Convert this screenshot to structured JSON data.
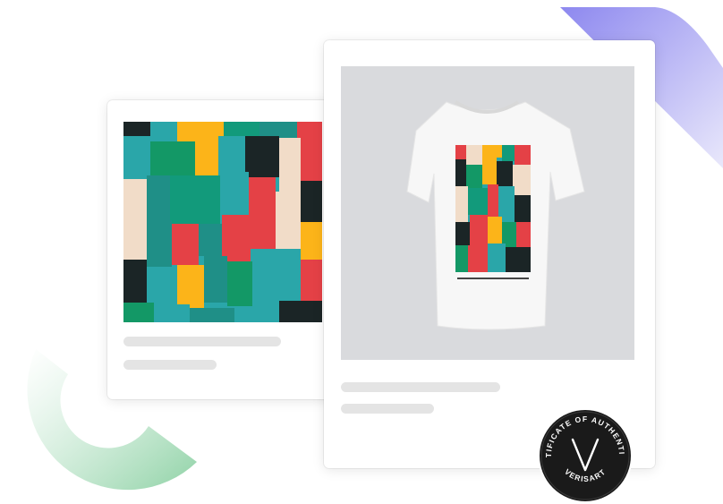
{
  "badge": {
    "ring_text": "CERTIFICATE OF AUTHENTICITY",
    "brand_text": "VERISART",
    "icon": "verisart-v-logo"
  },
  "colors": {
    "accent_purple": "#8a86ee",
    "accent_green": "#9ed8b0",
    "badge_bg": "#1a1a1a"
  },
  "artwork": {
    "icon": "abstract-color-grid-artwork"
  },
  "product": {
    "icon": "white-tshirt-with-print"
  }
}
